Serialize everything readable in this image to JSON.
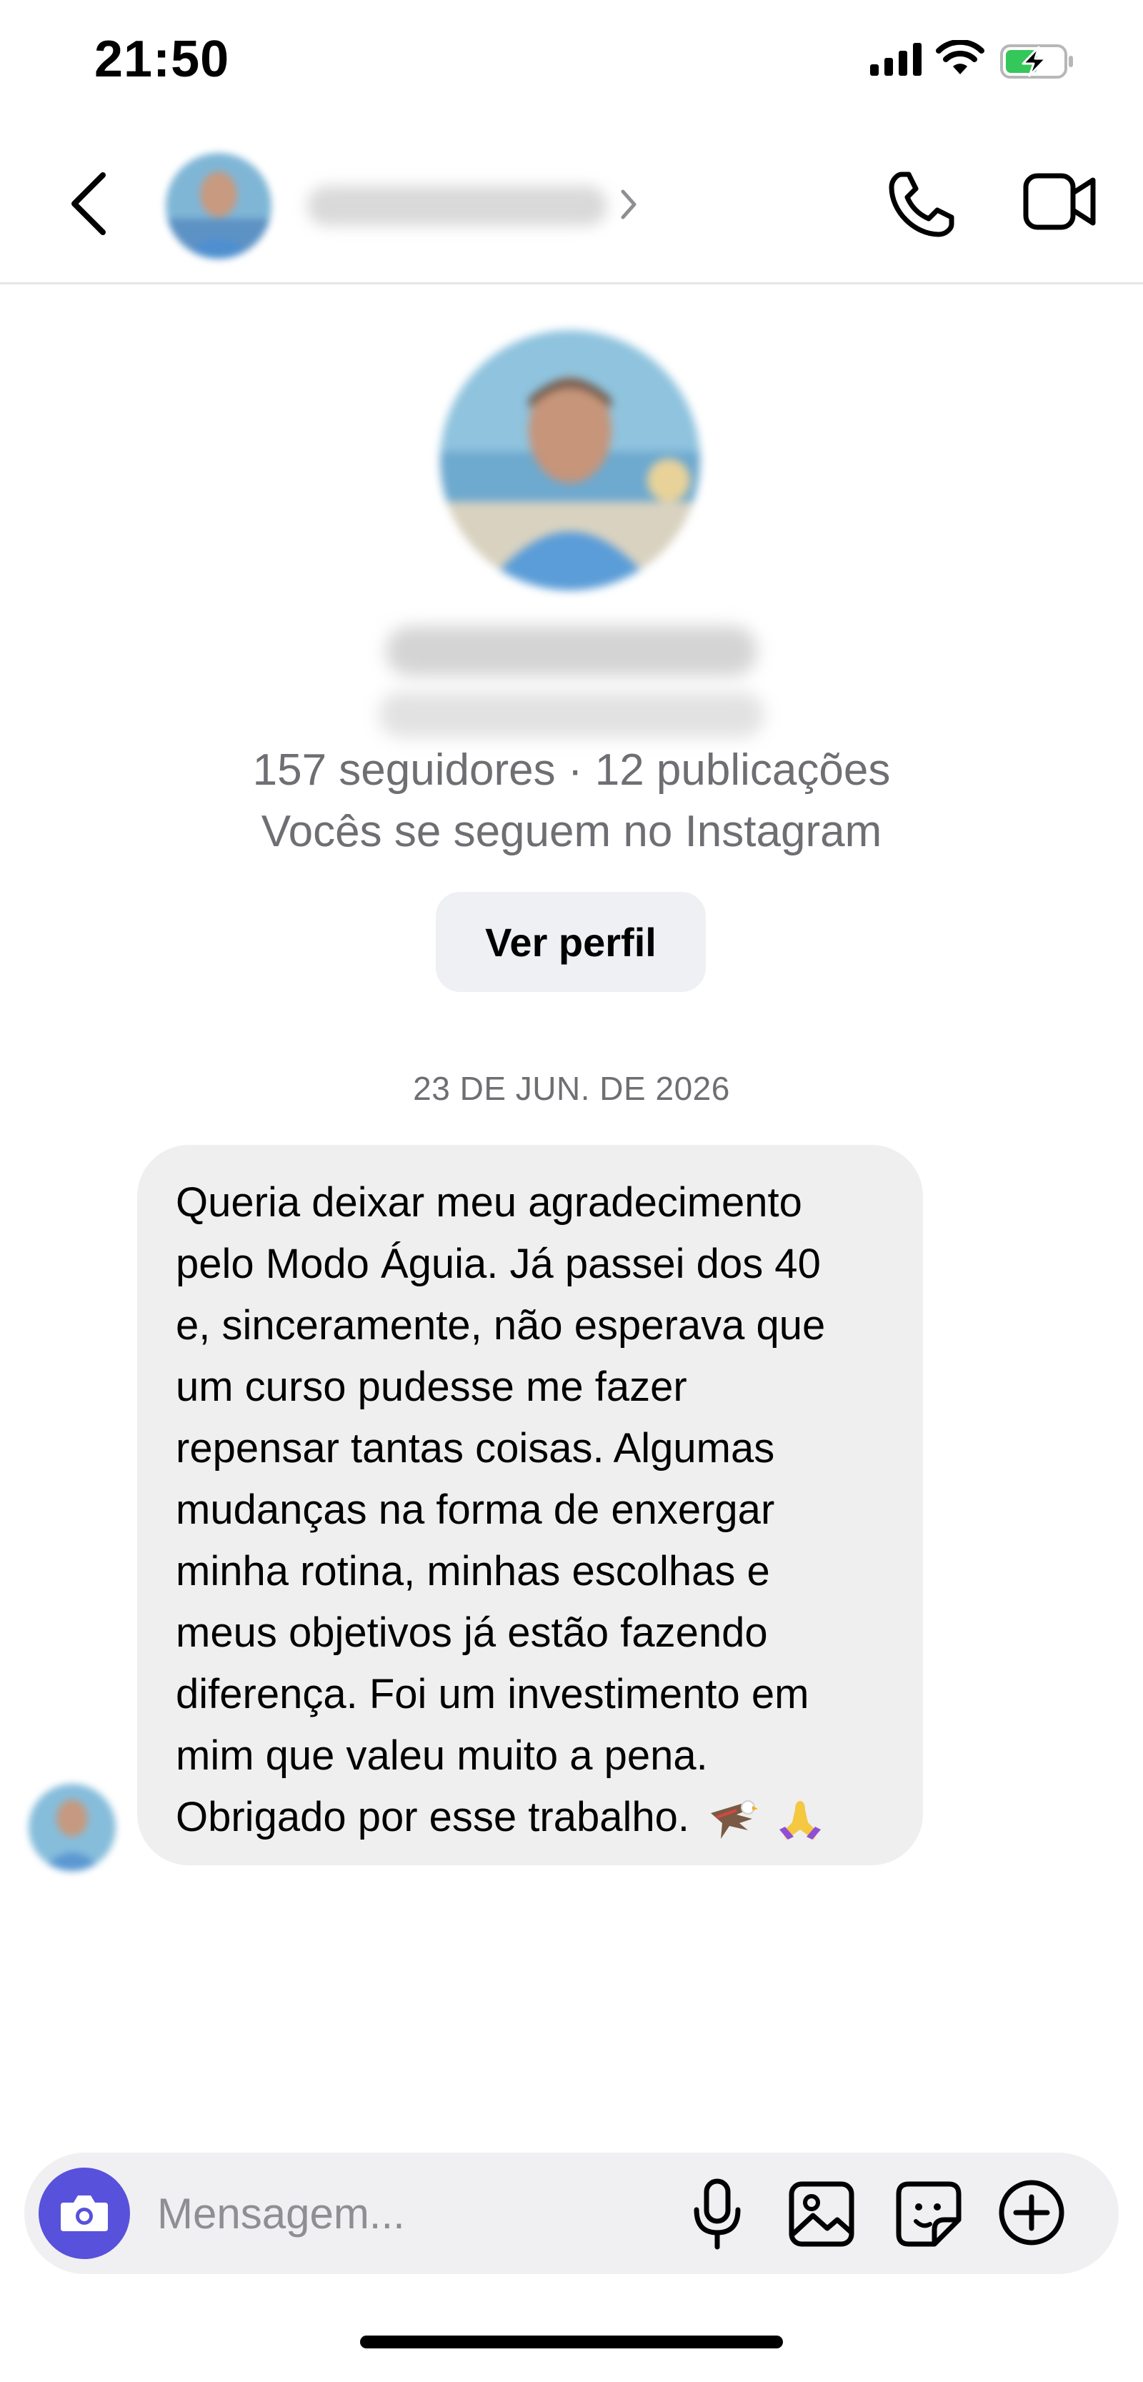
{
  "status_bar": {
    "time": "21:50",
    "icons": [
      "signal-icon",
      "wifi-icon",
      "battery-charging-icon"
    ],
    "battery_color": "#34c759"
  },
  "header": {
    "back_icon": "chevron-left-icon",
    "chevron": "›",
    "actions": [
      "phone-icon",
      "video-camera-icon"
    ]
  },
  "profile": {
    "stats": "157 seguidores · 12 publicações",
    "mutual": "Vocês se seguem no Instagram",
    "view_profile_label": "Ver perfil"
  },
  "conversation": {
    "date": "23 DE JUN. DE 2026",
    "message": {
      "lines": [
        "Queria deixar meu agradecimento",
        "pelo Modo Águia. Já passei dos 40",
        "e, sinceramente, não esperava que",
        "um curso pudesse me fazer",
        "repensar tantas coisas. Algumas",
        "mudanças na forma de enxergar",
        "minha rotina, minhas escolhas e",
        "meus objetivos já estão fazendo",
        "diferença. Foi um investimento em",
        "mim que valeu muito a pena.",
        "Obrigado por esse trabalho."
      ],
      "emojis": [
        "eagle-emoji",
        "praying-hands-emoji"
      ]
    }
  },
  "composer": {
    "placeholder": "Mensagem...",
    "accent": "#5851db",
    "icons": [
      "camera-icon",
      "microphone-icon",
      "gallery-icon",
      "sticker-icon",
      "plus-circle-icon"
    ]
  }
}
